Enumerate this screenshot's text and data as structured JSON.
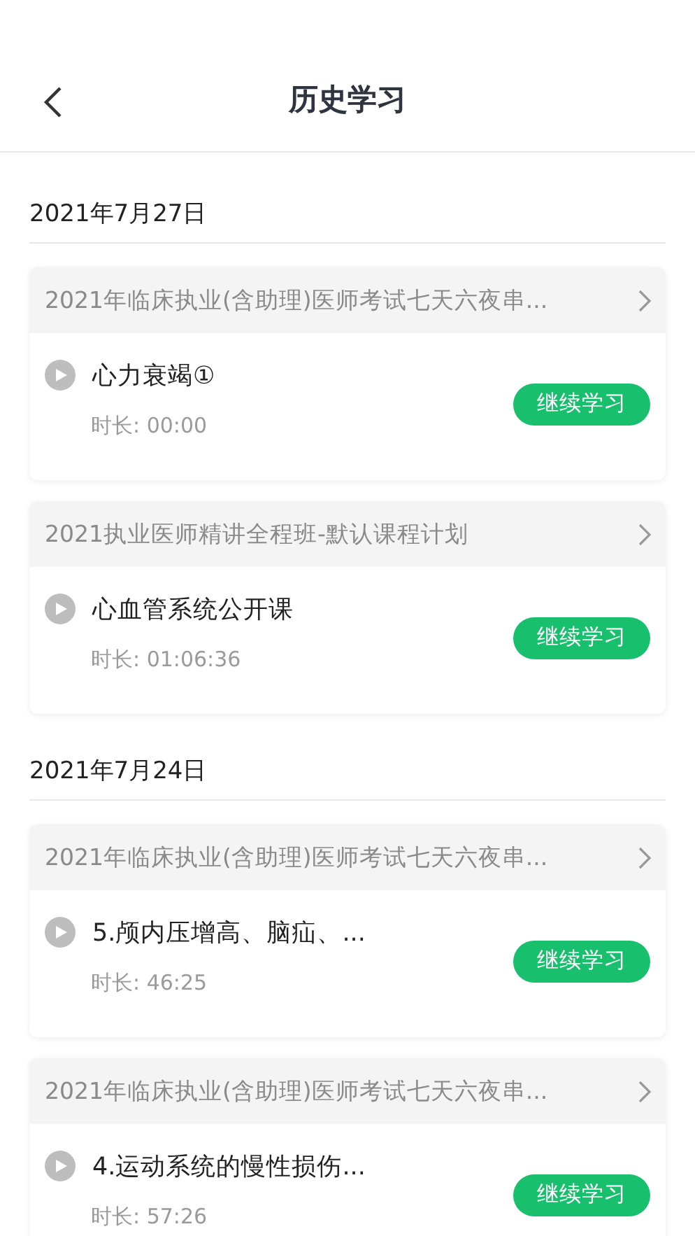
{
  "header": {
    "title": "历史学习"
  },
  "groups": [
    {
      "date": "2021年7月27日",
      "records": [
        {
          "course": "2021年临床执业(含助理)医师考试七天六夜串...",
          "lesson": "心力衰竭①",
          "duration": "时长: 00:00",
          "button": "继续学习"
        },
        {
          "course": "2021执业医师精讲全程班-默认课程计划",
          "lesson": "心血管系统公开课",
          "duration": "时长: 01:06:36",
          "button": "继续学习"
        }
      ]
    },
    {
      "date": "2021年7月24日",
      "records": [
        {
          "course": "2021年临床执业(含助理)医师考试七天六夜串...",
          "lesson": "5.颅内压增高、脑疝、...",
          "duration": "时长: 46:25",
          "button": "继续学习"
        },
        {
          "course": "2021年临床执业(含助理)医师考试七天六夜串...",
          "lesson": "4.运动系统的慢性损伤...",
          "duration": "时长: 57:26",
          "button": "继续学习"
        }
      ]
    }
  ]
}
